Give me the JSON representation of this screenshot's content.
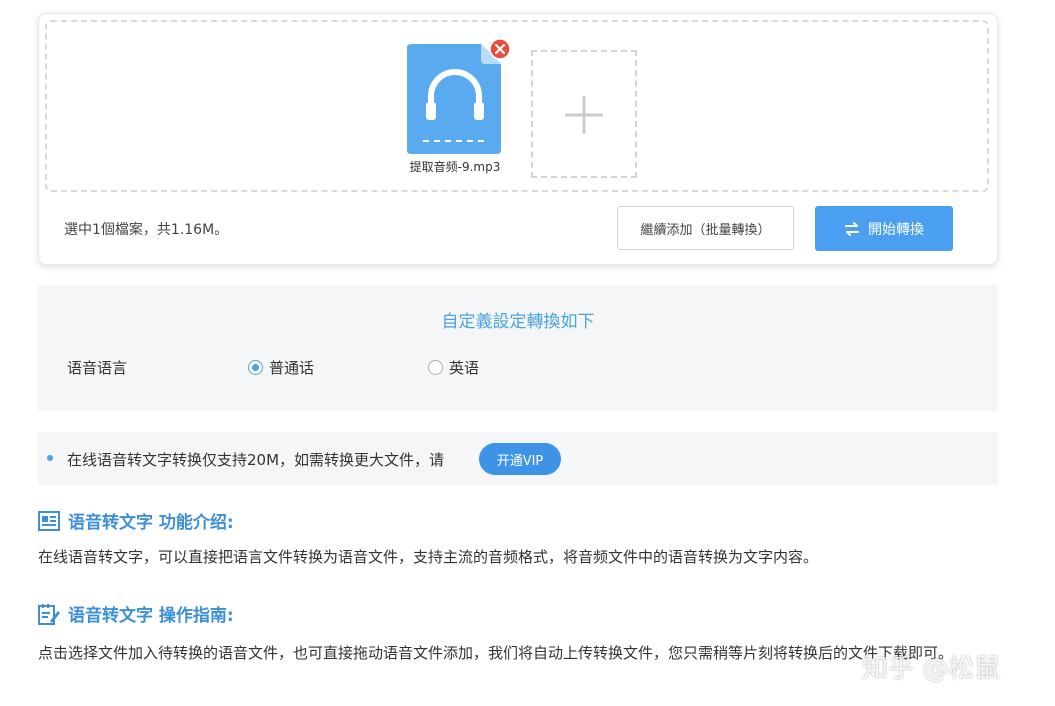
{
  "upload": {
    "file_name": "提取音频-9.mp3",
    "selection_status": "選中1個檔案，共1.16M。",
    "continue_label": "繼續添加（批量轉換）",
    "start_label": "開始轉換"
  },
  "settings": {
    "title": "自定義設定轉換如下",
    "language_label": "语音语言",
    "options": [
      {
        "label": "普通话",
        "selected": true
      },
      {
        "label": "英语",
        "selected": false
      }
    ]
  },
  "notice": {
    "text": "在线语音转文字转换仅支持20M，如需转换更大文件，请",
    "vip_label": "开通VIP"
  },
  "intro": {
    "heading": "语音转文字 功能介绍:",
    "body": "在线语音转文字，可以直接把语言文件转换为语音文件，支持主流的音频格式，将音频文件中的语音转换为文字内容。"
  },
  "guide": {
    "heading": "语音转文字 操作指南:",
    "body": "点击选择文件加入待转换的语音文件，也可直接拖动语音文件添加，我们将自动上传转换文件，您只需稍等片刻将转换后的文件下载即可。"
  },
  "watermark": "知乎 @松鼠",
  "colors": {
    "accent": "#4a9ff0",
    "file_icon": "#5aaaf0",
    "remove": "#e74c3c",
    "panel_bg": "#f5f6f7"
  }
}
